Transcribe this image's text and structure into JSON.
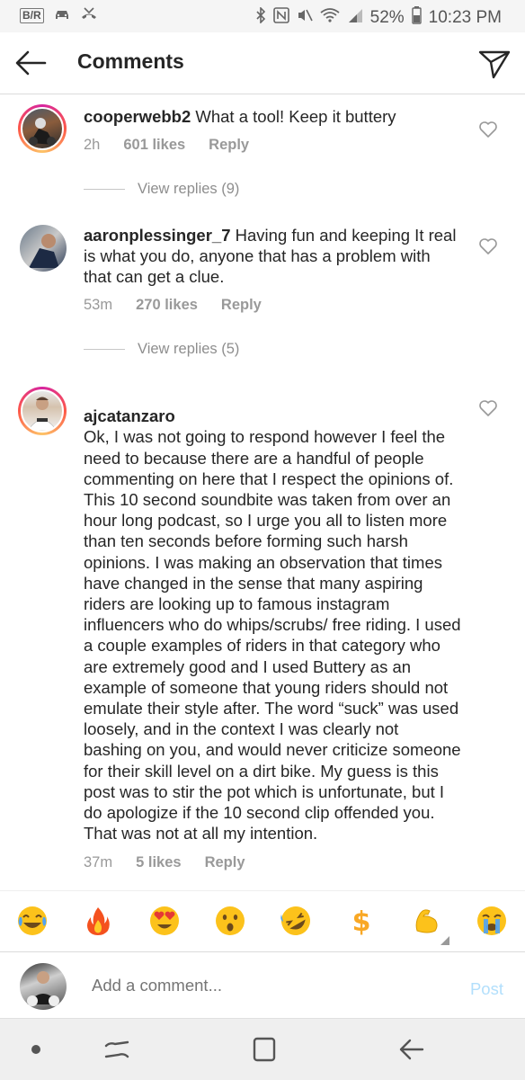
{
  "status_bar": {
    "left_icons": [
      "B/R",
      "car-icon",
      "missed-call-icon"
    ],
    "battery": "52%",
    "time": "10:23 PM"
  },
  "header": {
    "title": "Comments"
  },
  "comments": [
    {
      "username": "cooperwebb2",
      "text": "What a tool! Keep it buttery",
      "time": "2h",
      "likes": "601 likes",
      "reply": "Reply",
      "view_replies": "View replies (9)"
    },
    {
      "username": "aaronplessinger_7",
      "text": "Having fun and keeping It real is what you do, anyone that has a problem with that can get a clue.",
      "time": "53m",
      "likes": "270 likes",
      "reply": "Reply",
      "view_replies": "View replies (5)"
    },
    {
      "username": "ajcatanzaro",
      "text": "Ok, I  was not going to respond however I feel the need to because there are a handful of people commenting on here that I respect the opinions of.\nThis 10 second soundbite was taken from over an hour long podcast, so I urge you all to listen more than ten seconds before forming such harsh opinions. I was making an observation that times have changed in the sense that many aspiring riders are looking up to famous instagram influencers who do whips/scrubs/ free riding. I used a couple examples of riders in that category who are extremely good and I used Buttery as an example of someone that young riders should not emulate their style after. The word “suck” was used loosely, and in the context I was clearly not bashing on you, and would never criticize someone for their skill level on a dirt bike. My guess is this post was to stir the pot which is unfortunate, but I do apologize if the 10 second clip offended you. That was not at all my intention.",
      "time": "37m",
      "likes": "5 likes",
      "reply": "Reply"
    }
  ],
  "emoji_bar": [
    "😂",
    "🔥",
    "😍",
    "😮",
    "🤣",
    "💲",
    "💪",
    "😭"
  ],
  "composer": {
    "placeholder": "Add a comment...",
    "post_label": "Post"
  },
  "colors": {
    "text": "#262626",
    "meta": "#999999",
    "post_disabled": "#b2dffc",
    "divider": "#dbdbdb"
  }
}
